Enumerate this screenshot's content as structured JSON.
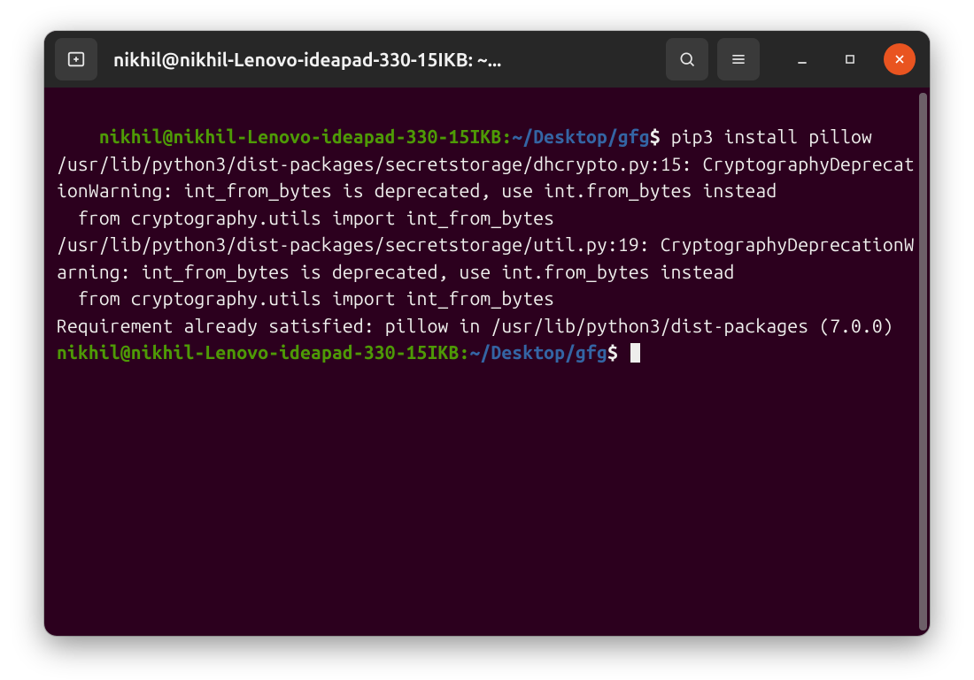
{
  "titlebar": {
    "title": "nikhil@nikhil-Lenovo-ideapad-330-15IKB: ~..."
  },
  "prompt": {
    "userhost": "nikhil@nikhil-Lenovo-ideapad-330-15IKB",
    "colon": ":",
    "tilde": "~",
    "path": "/Desktop/gfg",
    "dollar": "$"
  },
  "session": {
    "command1": " pip3 install pillow",
    "output1": "/usr/lib/python3/dist-packages/secretstorage/dhcrypto.py:15: CryptographyDeprecationWarning: int_from_bytes is deprecated, use int.from_bytes instead\n  from cryptography.utils import int_from_bytes\n/usr/lib/python3/dist-packages/secretstorage/util.py:19: CryptographyDeprecationWarning: int_from_bytes is deprecated, use int.from_bytes instead\n  from cryptography.utils import int_from_bytes\nRequirement already satisfied: pillow in /usr/lib/python3/dist-packages (7.0.0)"
  }
}
